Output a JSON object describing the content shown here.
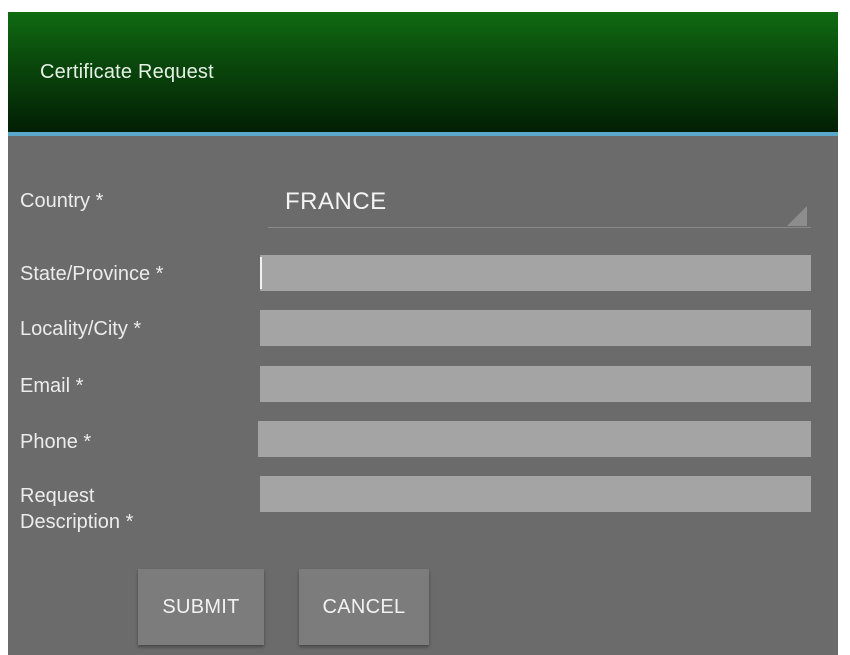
{
  "dialog": {
    "title": "Certificate Request"
  },
  "form": {
    "country": {
      "label": "Country *",
      "selected_value": "FRANCE"
    },
    "state": {
      "label": "State/Province *",
      "value": ""
    },
    "city": {
      "label": "Locality/City *",
      "value": ""
    },
    "email": {
      "label": "Email *",
      "value": ""
    },
    "phone": {
      "label": "Phone *",
      "value": ""
    },
    "description": {
      "label_line1": "Request",
      "label_line2": "Description *",
      "value": ""
    }
  },
  "buttons": {
    "submit": "SUBMIT",
    "cancel": "CANCEL"
  },
  "colors": {
    "title_gradient_top": "#0f6b12",
    "title_gradient_bottom": "#031f04",
    "divider": "#5aa7c9",
    "background": "#6b6b6b",
    "field": "#a4a4a4"
  },
  "icons": {
    "dropdown": "dropdown-corner-icon"
  }
}
